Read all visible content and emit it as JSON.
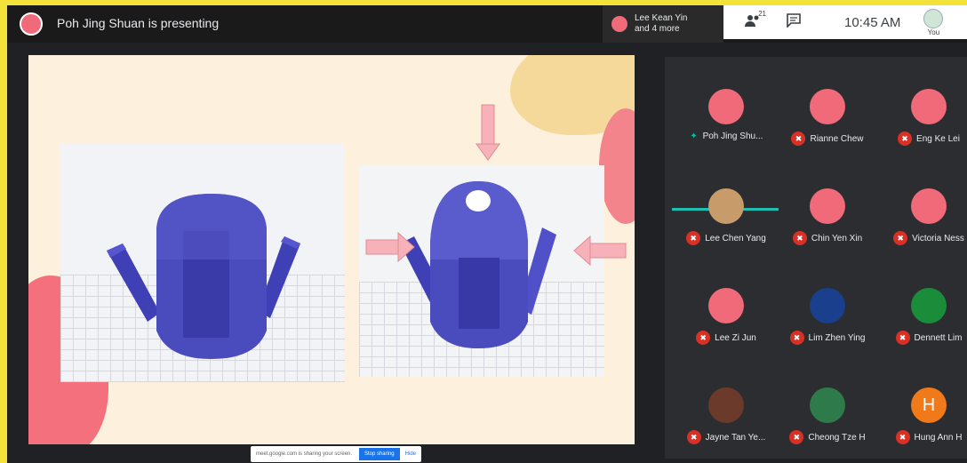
{
  "header": {
    "presenting_text": "Poh Jing Shuan is presenting",
    "others_line1": "Lee Kean Yin",
    "others_line2": "and 4 more",
    "people_count": "21",
    "time": "10:45 AM",
    "you_label": "You"
  },
  "share_bar": {
    "text": "meet.google.com is sharing your screen.",
    "stop_label": "Stop sharing",
    "hide_label": "Hide"
  },
  "participants": [
    {
      "name": "Poh Jing Shu...",
      "muted": false,
      "active": true,
      "avatar_color": "#f06a7a"
    },
    {
      "name": "Rianne Chew",
      "muted": true,
      "active": false,
      "avatar_color": "#f06a7a"
    },
    {
      "name": "Eng Ke Lei",
      "muted": true,
      "active": false,
      "avatar_color": "#f06a7a"
    },
    {
      "name": "Lee Chen Yang",
      "muted": true,
      "active": false,
      "avatar_color": "#c89b6a"
    },
    {
      "name": "Chin Yen Xin",
      "muted": true,
      "active": false,
      "avatar_color": "#f06a7a"
    },
    {
      "name": "Victoria Ness",
      "muted": true,
      "active": false,
      "avatar_color": "#f06a7a"
    },
    {
      "name": "Lee Zi Jun",
      "muted": true,
      "active": false,
      "avatar_color": "#f06a7a"
    },
    {
      "name": "Lim Zhen Ying",
      "muted": true,
      "active": false,
      "avatar_color": "#1a3f8c"
    },
    {
      "name": "Dennett Lim",
      "muted": true,
      "active": false,
      "avatar_color": "#1b8c3a"
    },
    {
      "name": "Jayne Tan Ye...",
      "muted": true,
      "active": false,
      "avatar_color": "#6b3a2a"
    },
    {
      "name": "Cheong Tze H",
      "muted": true,
      "active": false,
      "avatar_color": "#2f7a4a"
    },
    {
      "name": "Hung Ann H",
      "muted": true,
      "active": false,
      "avatar_color": "#f07a1a",
      "initial": "H"
    }
  ],
  "colors": {
    "accent": "#1fc0b4",
    "mic_off": "#d93025",
    "slide_bg": "#fdf0dd",
    "shape_blue": "#3f40b5"
  },
  "icons": {
    "people": "people-icon",
    "chat": "chat-icon",
    "mic_off": "mic-off-icon",
    "mic_on": "mic-on-icon"
  }
}
